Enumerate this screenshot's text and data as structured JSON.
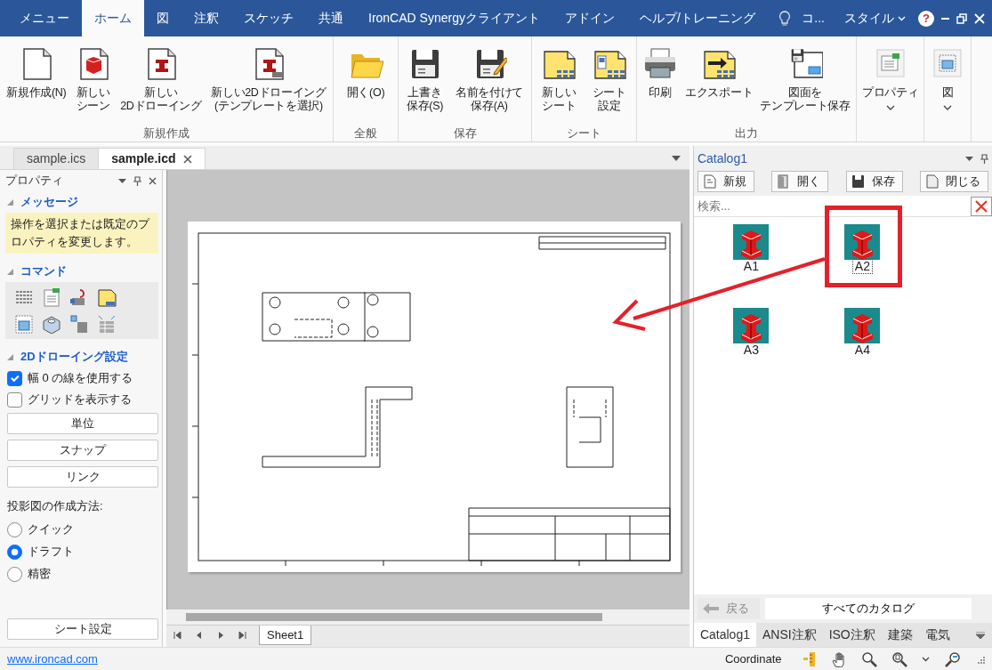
{
  "ribbon_tabs": [
    {
      "label": "メニュー",
      "selected": false
    },
    {
      "label": "ホーム",
      "selected": true
    },
    {
      "label": "図",
      "selected": false
    },
    {
      "label": "注釈",
      "selected": false
    },
    {
      "label": "スケッチ",
      "selected": false
    },
    {
      "label": "共通",
      "selected": false
    },
    {
      "label": "IronCAD Synergyクライアント",
      "selected": false
    },
    {
      "label": "アドイン",
      "selected": false
    },
    {
      "label": "ヘルプ/トレーニング",
      "selected": false
    }
  ],
  "title_bar": {
    "search_hint": "コ...",
    "style_menu": "スタイル",
    "help_button": "?"
  },
  "ribbon_groups": [
    {
      "label": "新規作成",
      "buttons": [
        {
          "kind": "new",
          "label": [
            "新規作成(N)"
          ]
        },
        {
          "kind": "scene",
          "label": [
            "新しい",
            "シーン"
          ]
        },
        {
          "kind": "drawing",
          "label": [
            "新しい",
            "2Dドローイング"
          ]
        },
        {
          "kind": "template",
          "label": [
            "新しい2Dドローイング",
            "(テンプレートを選択)"
          ]
        }
      ]
    },
    {
      "label": "全般",
      "buttons": [
        {
          "kind": "open",
          "label": [
            "開く(O)"
          ]
        }
      ]
    },
    {
      "label": "保存",
      "buttons": [
        {
          "kind": "save",
          "label": [
            "上書き",
            "保存(S)"
          ]
        },
        {
          "kind": "saveas",
          "label": [
            "名前を付けて",
            "保存(A)"
          ]
        }
      ]
    },
    {
      "label": "シート",
      "buttons": [
        {
          "kind": "sheet",
          "label": [
            "新しい",
            "シート"
          ]
        },
        {
          "kind": "sheetsetup",
          "label": [
            "シート",
            "設定"
          ]
        }
      ]
    },
    {
      "label": "出力",
      "buttons": [
        {
          "kind": "print",
          "label": [
            "印刷"
          ]
        },
        {
          "kind": "export",
          "label": [
            "エクスポート"
          ]
        },
        {
          "kind": "savetemplate",
          "label": [
            "図面を",
            "テンプレート保存"
          ]
        }
      ]
    },
    {
      "buttons": [
        {
          "kind": "properties",
          "label": [
            "プロパティ"
          ],
          "dropdown": true
        }
      ]
    },
    {
      "buttons": [
        {
          "kind": "view",
          "label": [
            "図"
          ],
          "dropdown": true
        }
      ]
    }
  ],
  "document_tabs": [
    {
      "label": "sample.ics",
      "selected": false
    },
    {
      "label": "sample.icd",
      "selected": true
    }
  ],
  "properties_panel": {
    "title": "プロパティ",
    "sections": [
      {
        "kind": "message",
        "heading": "メッセージ",
        "text": "操作を選択または既定のプロパティを変更します。"
      },
      {
        "kind": "commands",
        "heading": "コマンド"
      },
      {
        "kind": "settings",
        "heading": "2Dドローイング設定",
        "checkboxes": [
          {
            "label": "幅 0 の線を使用する",
            "checked": true
          },
          {
            "label": "グリッドを表示する",
            "checked": false
          }
        ],
        "buttons": [
          "単位",
          "スナップ",
          "リンク"
        ],
        "projection_label": "投影図の作成方法:",
        "radios": [
          {
            "label": "クイック",
            "selected": false
          },
          {
            "label": "ドラフト",
            "selected": true
          },
          {
            "label": "精密",
            "selected": false
          }
        ]
      }
    ],
    "footer_button": "シート設定"
  },
  "drawing_area": {
    "sheet_tabs": [
      {
        "label": "Sheet1",
        "selected": true
      }
    ]
  },
  "catalog_panel": {
    "title": "Catalog1",
    "toolbar": [
      {
        "kind": "new",
        "label": "新規"
      },
      {
        "kind": "open",
        "label": "開く"
      },
      {
        "kind": "save",
        "label": "保存"
      },
      {
        "kind": "close",
        "label": "閉じる"
      }
    ],
    "search": {
      "placeholder": "検索..."
    },
    "items": [
      {
        "label": "A1",
        "selected": false
      },
      {
        "label": "A2",
        "selected": true
      },
      {
        "label": "A3",
        "selected": false
      },
      {
        "label": "A4",
        "selected": false
      }
    ],
    "back_button": {
      "label": "戻る",
      "disabled": true
    },
    "all_catalogs_button": "すべてのカタログ",
    "tabs": [
      {
        "label": "Catalog1",
        "selected": true
      },
      {
        "label": "ANSI注釈",
        "selected": false
      },
      {
        "label": "ISO注釈",
        "selected": false
      },
      {
        "label": "建築",
        "selected": false
      },
      {
        "label": "電気",
        "selected": false
      }
    ]
  },
  "status_bar": {
    "link": "www.ironcad.com",
    "coordinate": "Coordinate"
  }
}
